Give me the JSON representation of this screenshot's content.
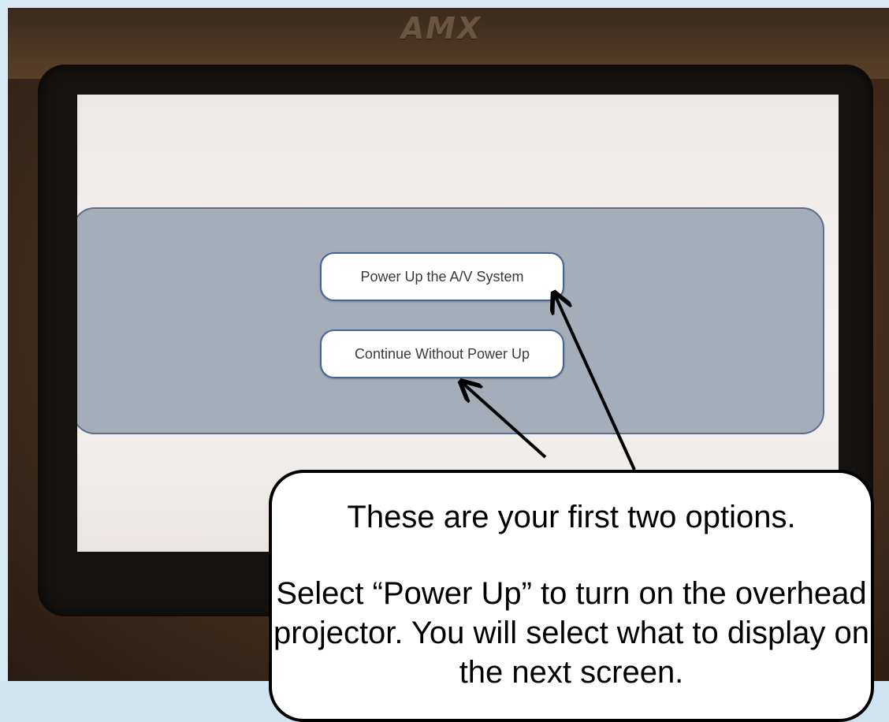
{
  "device": {
    "logo_text": "AMX"
  },
  "screen": {
    "buttons": [
      {
        "label": "Power Up the A/V System"
      },
      {
        "label": "Continue Without Power Up"
      }
    ]
  },
  "callout": {
    "line1": "These are your first two options.",
    "line2": "Select “Power Up” to turn on the overhead projector.  You will select what to display on the next screen."
  },
  "colors": {
    "panel_fill": "#a5aeb8",
    "panel_border": "#5b6f8d",
    "button_border": "#45629a",
    "frame_border": "#d7e9f5"
  }
}
